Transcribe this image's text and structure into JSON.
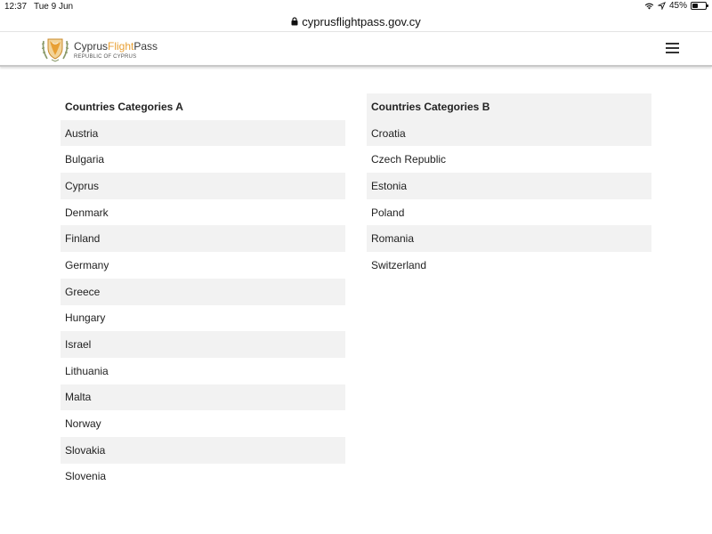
{
  "status_bar": {
    "time": "12:37",
    "date": "Tue 9 Jun",
    "battery_percent_label": "45%",
    "battery_level": 0.45
  },
  "browser": {
    "url": "cyprusflightpass.gov.cy"
  },
  "header": {
    "brand_part1": "Cyprus",
    "brand_part2": "Flight",
    "brand_part3": "Pass",
    "subtitle": "REPUBLIC OF CYPRUS",
    "accent_color": "#e8a034"
  },
  "category_a": {
    "heading": "Countries Categories A",
    "countries": [
      "Austria",
      "Bulgaria",
      "Cyprus",
      "Denmark",
      "Finland",
      "Germany",
      "Greece",
      "Hungary",
      "Israel",
      "Lithuania",
      "Malta",
      "Norway",
      "Slovakia",
      "Slovenia"
    ]
  },
  "category_b": {
    "heading": "Countries Categories B",
    "countries": [
      "Croatia",
      "Czech Republic",
      "Estonia",
      "Poland",
      "Romania",
      "Switzerland"
    ]
  },
  "icons": [
    "wifi-icon",
    "location-arrow-icon",
    "battery-icon",
    "lock-icon",
    "cyprus-emblem-icon",
    "hamburger-menu-icon"
  ]
}
